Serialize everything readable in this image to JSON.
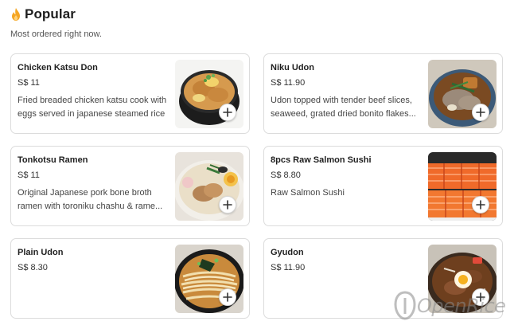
{
  "section": {
    "title": "Popular",
    "subtitle": "Most ordered right now.",
    "title_icon": "fire-icon"
  },
  "items": [
    {
      "name": "Chicken Katsu Don",
      "price": "S$ 11",
      "description": "Fried breaded chicken katsu cook with eggs served in japanese steamed rice",
      "image": "katsu-don-bowl-image",
      "action_icon": "plus-icon"
    },
    {
      "name": "Niku Udon",
      "price": "S$ 11.90",
      "description": "Udon topped with tender beef slices, seaweed, grated dried bonito flakes...",
      "image": "niku-udon-bowl-image",
      "action_icon": "plus-icon"
    },
    {
      "name": "Tonkotsu Ramen",
      "price": "S$ 11",
      "description": "Original Japanese pork bone broth ramen with toroniku chashu & rame...",
      "image": "tonkotsu-ramen-bowl-image",
      "action_icon": "plus-icon"
    },
    {
      "name": "8pcs Raw Salmon Sushi",
      "price": "S$ 8.80",
      "description": "Raw Salmon Sushi",
      "image": "salmon-sushi-image",
      "action_icon": "plus-icon"
    },
    {
      "name": "Plain Udon",
      "price": "S$ 8.30",
      "description": "",
      "image": "plain-udon-bowl-image",
      "action_icon": "plus-icon"
    },
    {
      "name": "Gyudon",
      "price": "S$ 11.90",
      "description": "",
      "image": "gyudon-bowl-image",
      "action_icon": "plus-icon"
    }
  ],
  "watermark": {
    "text": "OpenRice"
  },
  "colors": {
    "card_border": "#dcdcdc",
    "fire": "#f5a623",
    "title": "#1e1e1e"
  }
}
